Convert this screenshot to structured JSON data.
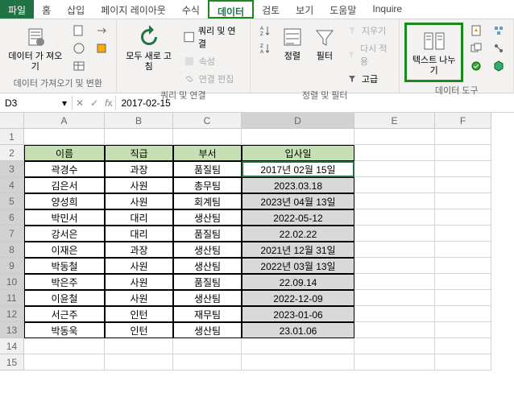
{
  "tabs": {
    "file": "파일",
    "home": "홈",
    "insert": "삽입",
    "layout": "페이지 레이아웃",
    "formula": "수식",
    "data": "데이터",
    "review": "검토",
    "view": "보기",
    "help": "도움말",
    "inquire": "Inquire"
  },
  "ribbon": {
    "get_data": "데이터 가\n져오기",
    "refresh": "모두 새로\n고침",
    "queries": "쿼리 및 연결",
    "properties": "속성",
    "edit_links": "연결 편집",
    "sort": "정렬",
    "filter": "필터",
    "clear": "지우기",
    "reapply": "다시 적용",
    "advanced": "고급",
    "text_cols": "텍스트\n나누기",
    "g1": "데이터 가져오기 및 변환",
    "g2": "쿼리 및 연결",
    "g3": "정렬 및 필터",
    "g4": "데이터 도구"
  },
  "namebox": "D3",
  "formula": "2017-02-15",
  "cols": [
    "A",
    "B",
    "C",
    "D",
    "E",
    "F"
  ],
  "headers": [
    "이름",
    "직급",
    "부서",
    "입사일"
  ],
  "rows": [
    {
      "n": "3",
      "c": [
        "곽경수",
        "과장",
        "품질팀",
        "2017년 02월 15일"
      ]
    },
    {
      "n": "4",
      "c": [
        "김은서",
        "사원",
        "총무팀",
        "2023.03.18"
      ]
    },
    {
      "n": "5",
      "c": [
        "양성희",
        "사원",
        "회계팀",
        "2023년 04월 13일"
      ]
    },
    {
      "n": "6",
      "c": [
        "박민서",
        "대리",
        "생산팀",
        "2022-05-12"
      ]
    },
    {
      "n": "7",
      "c": [
        "강서은",
        "대리",
        "품질팀",
        "22.02.22"
      ]
    },
    {
      "n": "8",
      "c": [
        "이재은",
        "과장",
        "생산팀",
        "2021년 12월 31일"
      ]
    },
    {
      "n": "9",
      "c": [
        "박동철",
        "사원",
        "생산팀",
        "2022년 03월 13일"
      ]
    },
    {
      "n": "10",
      "c": [
        "박은주",
        "사원",
        "품질팀",
        "22.09.14"
      ]
    },
    {
      "n": "11",
      "c": [
        "이윤철",
        "사원",
        "생산팀",
        "2022-12-09"
      ]
    },
    {
      "n": "12",
      "c": [
        "서근주",
        "인턴",
        "재무팀",
        "2023-01-06"
      ]
    },
    {
      "n": "13",
      "c": [
        "박동욱",
        "인턴",
        "생산팀",
        "23.01.06"
      ]
    }
  ]
}
